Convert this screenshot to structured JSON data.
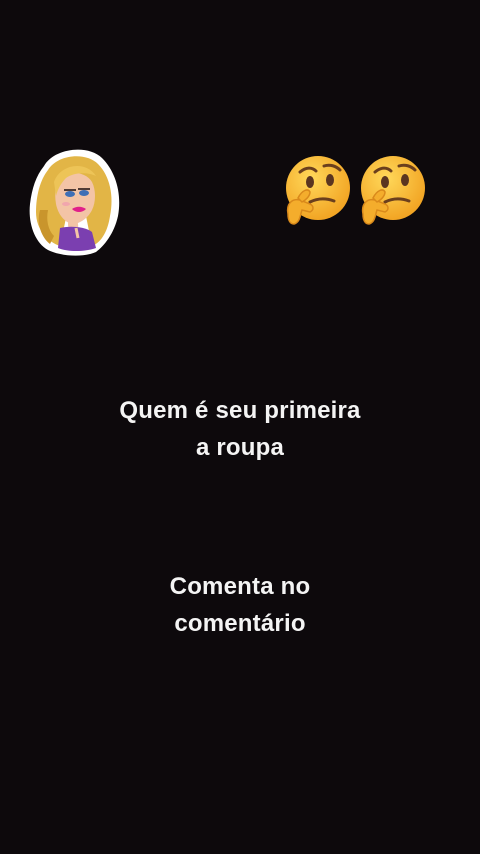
{
  "stickers": {
    "woman_sticker": "cartoon-woman-sticker",
    "emojis": [
      "thinking-face-emoji",
      "thinking-face-emoji"
    ]
  },
  "captions": {
    "question": {
      "line1": "Quem é seu primeira",
      "line2": "a roupa"
    },
    "comment": {
      "line1": "Comenta no",
      "line2": "comentário"
    }
  },
  "colors": {
    "background": "#0d090c",
    "text": "#f4f4f4",
    "emoji_face": "#f6b83a"
  }
}
